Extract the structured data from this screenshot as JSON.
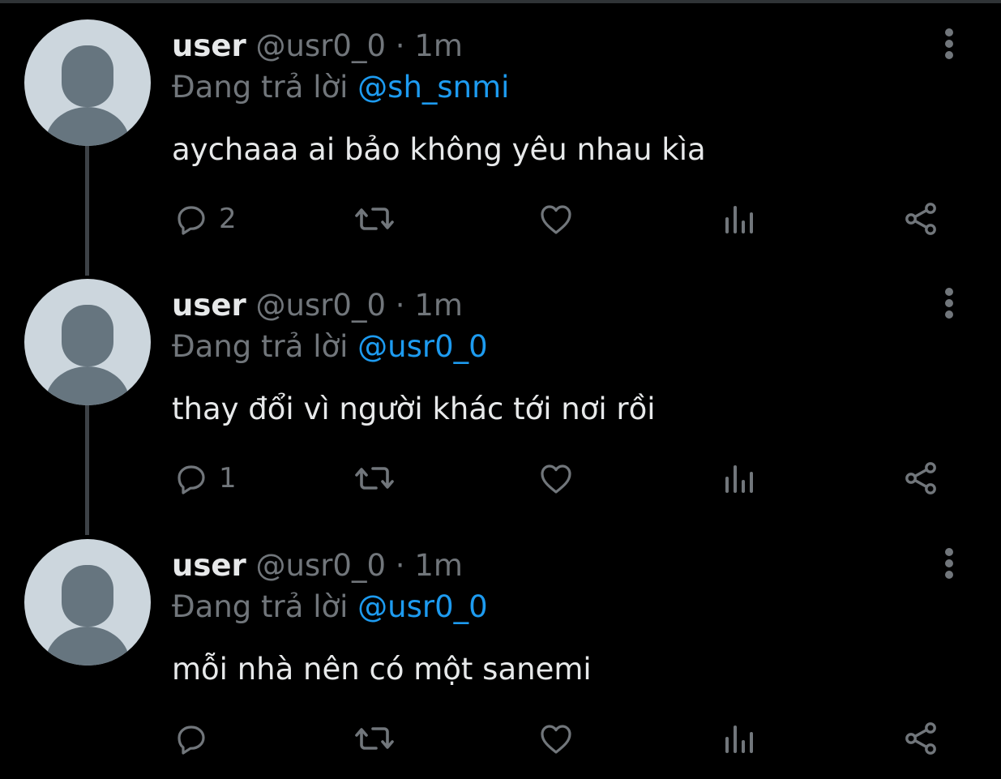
{
  "colors": {
    "background": "#000000",
    "text_primary": "#e7e9ea",
    "text_secondary": "#71767b",
    "link": "#1d9bf0",
    "thread_line": "#3d4247",
    "avatar_bg": "#ccd6dd",
    "avatar_fg": "#66757f"
  },
  "icons": {
    "reply": "reply-icon",
    "retweet": "retweet-icon",
    "like": "heart-icon",
    "views": "analytics-icon",
    "share": "share-icon",
    "more": "more-vertical-icon"
  },
  "tweets": [
    {
      "name": "user",
      "handle": "@usr0_0",
      "separator": "·",
      "time": "1m",
      "reply_prefix": "Đang trả lời",
      "reply_to": "@sh_snmi",
      "text": "aychaaa ai bảo không yêu nhau kìa",
      "reply_count": "2"
    },
    {
      "name": "user",
      "handle": "@usr0_0",
      "separator": "·",
      "time": "1m",
      "reply_prefix": "Đang trả lời",
      "reply_to": "@usr0_0",
      "text": "thay đổi vì người khác tới nơi rồi",
      "reply_count": "1"
    },
    {
      "name": "user",
      "handle": "@usr0_0",
      "separator": "·",
      "time": "1m",
      "reply_prefix": "Đang trả lời",
      "reply_to": "@usr0_0",
      "text": "mỗi nhà nên có một sanemi",
      "reply_count": ""
    }
  ]
}
